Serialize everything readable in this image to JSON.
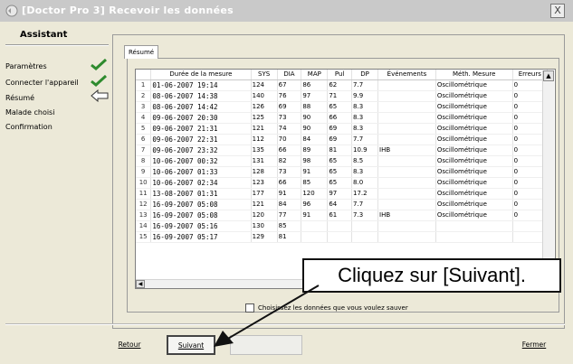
{
  "window": {
    "title": "[Doctor Pro 3] Recevoir les données",
    "close_label": "X"
  },
  "sidebar": {
    "title": "Assistant",
    "items": [
      {
        "label": "Paramètres",
        "icon": "check-icon"
      },
      {
        "label": "Connecter l'appareil",
        "icon": "check-icon"
      },
      {
        "label": "Résumé",
        "icon": "arrow-left-icon"
      },
      {
        "label": "Malade choisi",
        "icon": ""
      },
      {
        "label": "Confirmation",
        "icon": ""
      }
    ]
  },
  "tab": {
    "label": "Résumé"
  },
  "table": {
    "columns": [
      "",
      "Durée de la mesure",
      "SYS",
      "DIA",
      "MAP",
      "Pul",
      "DP",
      "Événements",
      "Méth. Mesure",
      "Erreurs"
    ],
    "rows": [
      [
        "1",
        "01-06-2007 19:14",
        "124",
        "67",
        "86",
        "62",
        "7.7",
        "",
        "Oscillométrique",
        "0"
      ],
      [
        "2",
        "08-06-2007 14:38",
        "140",
        "76",
        "97",
        "71",
        "9.9",
        "",
        "Oscillométrique",
        "0"
      ],
      [
        "3",
        "08-06-2007 14:42",
        "126",
        "69",
        "88",
        "65",
        "8.3",
        "",
        "Oscillométrique",
        "0"
      ],
      [
        "4",
        "09-06-2007 20:30",
        "125",
        "73",
        "90",
        "66",
        "8.3",
        "",
        "Oscillométrique",
        "0"
      ],
      [
        "5",
        "09-06-2007 21:31",
        "121",
        "74",
        "90",
        "69",
        "8.3",
        "",
        "Oscillométrique",
        "0"
      ],
      [
        "6",
        "09-06-2007 22:31",
        "112",
        "70",
        "84",
        "69",
        "7.7",
        "",
        "Oscillométrique",
        "0"
      ],
      [
        "7",
        "09-06-2007 23:32",
        "135",
        "66",
        "89",
        "81",
        "10.9",
        "IHB",
        "Oscillométrique",
        "0"
      ],
      [
        "8",
        "10-06-2007 00:32",
        "131",
        "82",
        "98",
        "65",
        "8.5",
        "",
        "Oscillométrique",
        "0"
      ],
      [
        "9",
        "10-06-2007 01:33",
        "128",
        "73",
        "91",
        "65",
        "8.3",
        "",
        "Oscillométrique",
        "0"
      ],
      [
        "10",
        "10-06-2007 02:34",
        "123",
        "66",
        "85",
        "65",
        "8.0",
        "",
        "Oscillométrique",
        "0"
      ],
      [
        "11",
        "13-08-2007 01:31",
        "177",
        "91",
        "120",
        "97",
        "17.2",
        "",
        "Oscillométrique",
        "0"
      ],
      [
        "12",
        "16-09-2007 05:08",
        "121",
        "84",
        "96",
        "64",
        "7.7",
        "",
        "Oscillométrique",
        "0"
      ],
      [
        "13",
        "16-09-2007 05:08",
        "120",
        "77",
        "91",
        "61",
        "7.3",
        "IHB",
        "Oscillométrique",
        "0"
      ],
      [
        "14",
        "16-09-2007 05:16",
        "130",
        "85",
        "",
        "",
        "",
        "",
        "",
        ""
      ],
      [
        "15",
        "16-09-2007 05:17",
        "129",
        "81",
        "",
        "",
        "",
        "",
        "",
        ""
      ]
    ]
  },
  "checkbox": {
    "label": "Choisissez les données que vous voulez sauver"
  },
  "callout": {
    "text": "Cliquez sur [Suivant]."
  },
  "buttons": {
    "back": "Retour",
    "next": "Suivant",
    "finish": "Fermer"
  },
  "colors": {
    "check": "#2e8b2e",
    "title_text": "#ffffff"
  }
}
